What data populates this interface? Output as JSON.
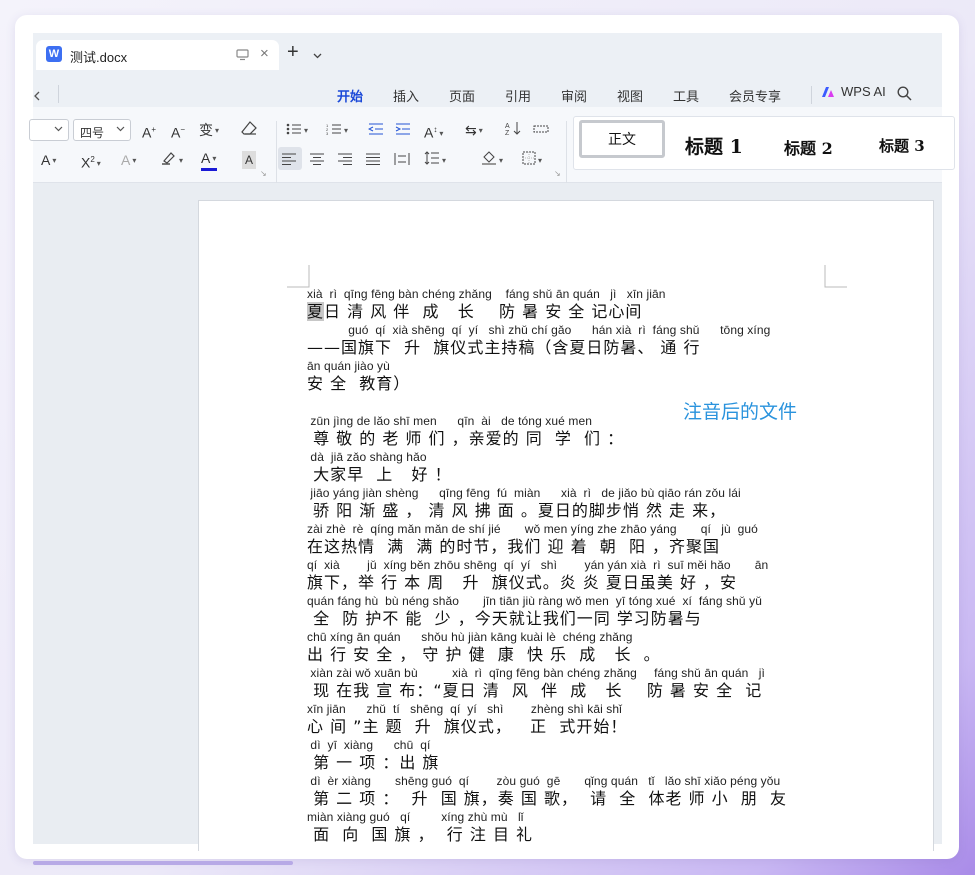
{
  "window": {
    "tab": {
      "title": "测试.docx",
      "logo_letter": "W"
    },
    "new_tab_symbol": "+"
  },
  "menu": {
    "items": [
      "开始",
      "插入",
      "页面",
      "引用",
      "审阅",
      "视图",
      "工具",
      "会员专享"
    ],
    "active_index": 0,
    "ai_label": "WPS AI"
  },
  "ribbon": {
    "font_size_value": "四号",
    "styles": [
      "正文",
      "标题 1",
      "标题 2",
      "标题 3"
    ],
    "font_color_underline": "#1a1ad6"
  },
  "document": {
    "lines": [
      {
        "pinyin": "xià  rì  qīng fēng bàn chéng zhǎng    fáng shǔ ān quán   jì   xīn jiān",
        "hanzi": "夏日 清 风 伴  成   长    防 暑 安 全 记心间",
        "highlight_first": true
      },
      {
        "pinyin": "            guó  qí  xià shēng  qí  yí   shì zhǔ chí gǎo      hán xià  rì  fáng shǔ      tōng xíng",
        "hanzi": "——国旗下  升  旗仪式主持稿（含夏日防暑、 通 行"
      },
      {
        "pinyin": "ān quán jiào yù",
        "hanzi": "安 全  教育）"
      },
      {
        "pinyin": " zūn jìng de lǎo shī men      qīn  ài   de tóng xué men",
        "hanzi": " 尊 敬 的 老 师 们 ，亲爱的 同  学  们 ："
      },
      {
        "pinyin": " dà  jiā zǎo shàng hǎo",
        "hanzi": " 大家早  上   好 ！"
      },
      {
        "pinyin": " jiāo yáng jiàn shèng      qīng fēng  fú  miàn      xià  rì   de jiǎo bù qiāo rán zǒu lái",
        "hanzi": " 骄 阳 渐 盛 ， 清 风 拂 面 。夏日的脚步悄 然 走 来，"
      },
      {
        "pinyin": "zài zhè  rè  qíng mǎn mǎn de shí jié       wǒ men yíng zhe zhāo yáng       qí   jù  guó",
        "hanzi": "在这热情  满  满 的时节，我们 迎 着  朝  阳 ，齐聚国"
      },
      {
        "pinyin": "qí  xià        jǔ  xíng běn zhōu shēng  qí  yí   shì        yán yán xià  rì  suī měi hǎo       ān",
        "hanzi": "旗下，举 行 本 周   升  旗仪式。炎 炎 夏日虽美 好 ，安"
      },
      {
        "pinyin": "quán fáng hù  bù néng shǎo       jīn tiān jiù ràng wǒ men  yī tóng xué  xí  fáng shǔ yǔ",
        "hanzi": " 全  防 护不 能  少 ，今天就让我们一同 学习防暑与"
      },
      {
        "pinyin": "chū xíng ān quán      shǒu hù jiàn kāng kuài lè  chéng zhǎng",
        "hanzi": "出 行 安 全 ， 守 护 健  康  快 乐  成   长  。"
      },
      {
        "pinyin": " xiàn zài wǒ xuān bù          xià  rì  qīng fēng bàn chéng zhǎng     fáng shǔ ān quán   jì",
        "hanzi": " 现 在我 宣 布：“夏日 清  风  伴  成   长    防 暑 安 全  记"
      },
      {
        "pinyin": "xīn jiān      zhǔ  tí   shēng  qí  yí   shì        zhèng shì kāi shǐ",
        "hanzi": "心 间 ”主 题  升  旗仪式，   正  式开始！"
      },
      {
        "pinyin": " dì  yī  xiàng      chū  qí",
        "hanzi": " 第 一 项 ：出 旗"
      },
      {
        "pinyin": " dì  èr xiàng       shēng guó  qí        zòu guó  gē       qǐng quán   tǐ   lǎo shī xiǎo péng yǒu",
        "hanzi": " 第 二 项 ：  升  国 旗，奏 国 歌，  请  全  体老 师 小  朋  友"
      },
      {
        "pinyin": "miàn xiàng guó   qí         xíng zhù mù   lǐ",
        "hanzi": " 面  向  国 旗 ，  行 注 目 礼"
      }
    ],
    "annotation": "注音后的文件"
  }
}
